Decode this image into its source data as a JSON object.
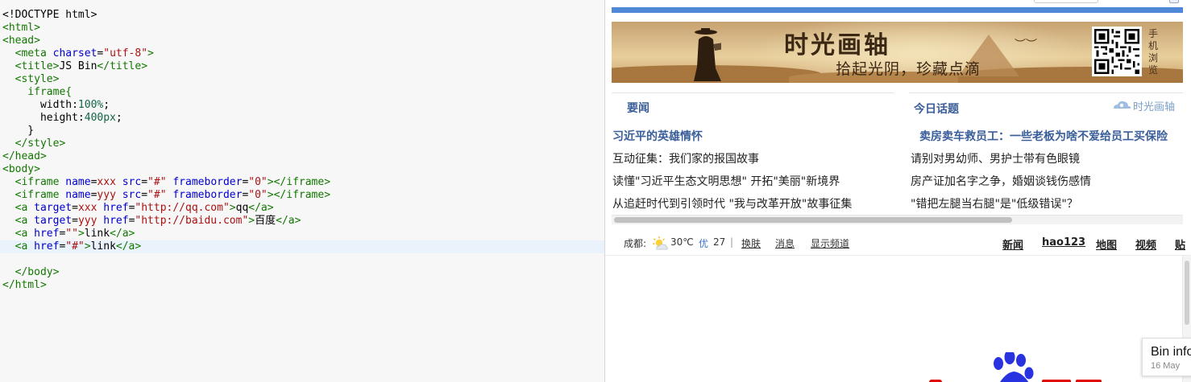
{
  "editor": {
    "lines": [
      {
        "tokens": [
          {
            "t": "<!DOCTYPE html>",
            "c": "pr"
          }
        ]
      },
      {
        "tokens": [
          {
            "t": "<html>",
            "c": "tg"
          }
        ]
      },
      {
        "tokens": [
          {
            "t": "<head>",
            "c": "tg"
          }
        ]
      },
      {
        "tokens": [
          {
            "t": "  ",
            "c": "pr"
          },
          {
            "t": "<meta ",
            "c": "tg"
          },
          {
            "t": "charset",
            "c": "at"
          },
          {
            "t": "=",
            "c": "pr"
          },
          {
            "t": "\"utf-8\"",
            "c": "st"
          },
          {
            "t": ">",
            "c": "tg"
          }
        ]
      },
      {
        "tokens": [
          {
            "t": "  ",
            "c": "pr"
          },
          {
            "t": "<title>",
            "c": "tg"
          },
          {
            "t": "JS Bin",
            "c": "pr"
          },
          {
            "t": "</title>",
            "c": "tg"
          }
        ]
      },
      {
        "tokens": [
          {
            "t": "  ",
            "c": "pr"
          },
          {
            "t": "<style>",
            "c": "tg"
          }
        ]
      },
      {
        "tokens": [
          {
            "t": "    iframe{",
            "c": "tg"
          }
        ]
      },
      {
        "tokens": [
          {
            "t": "      width:",
            "c": "pr"
          },
          {
            "t": "100%",
            "c": "nm"
          },
          {
            "t": ";",
            "c": "pr"
          }
        ]
      },
      {
        "tokens": [
          {
            "t": "      height:",
            "c": "pr"
          },
          {
            "t": "400px",
            "c": "nm"
          },
          {
            "t": ";",
            "c": "pr"
          }
        ]
      },
      {
        "tokens": [
          {
            "t": "    }",
            "c": "pr"
          }
        ]
      },
      {
        "tokens": [
          {
            "t": "  ",
            "c": "pr"
          },
          {
            "t": "</style>",
            "c": "tg"
          }
        ]
      },
      {
        "tokens": [
          {
            "t": "</head>",
            "c": "tg"
          }
        ]
      },
      {
        "tokens": [
          {
            "t": "<body>",
            "c": "tg"
          }
        ]
      },
      {
        "tokens": [
          {
            "t": "  ",
            "c": "pr"
          },
          {
            "t": "<iframe ",
            "c": "tg"
          },
          {
            "t": "name",
            "c": "at"
          },
          {
            "t": "=",
            "c": "pr"
          },
          {
            "t": "xxx ",
            "c": "st"
          },
          {
            "t": "src",
            "c": "at"
          },
          {
            "t": "=",
            "c": "pr"
          },
          {
            "t": "\"#\" ",
            "c": "st"
          },
          {
            "t": "frameborder",
            "c": "at"
          },
          {
            "t": "=",
            "c": "pr"
          },
          {
            "t": "\"0\"",
            "c": "st"
          },
          {
            "t": "></iframe>",
            "c": "tg"
          }
        ]
      },
      {
        "tokens": [
          {
            "t": "  ",
            "c": "pr"
          },
          {
            "t": "<iframe ",
            "c": "tg"
          },
          {
            "t": "name",
            "c": "at"
          },
          {
            "t": "=",
            "c": "pr"
          },
          {
            "t": "yyy ",
            "c": "st"
          },
          {
            "t": "src",
            "c": "at"
          },
          {
            "t": "=",
            "c": "pr"
          },
          {
            "t": "\"#\" ",
            "c": "st"
          },
          {
            "t": "frameborder",
            "c": "at"
          },
          {
            "t": "=",
            "c": "pr"
          },
          {
            "t": "\"0\"",
            "c": "st"
          },
          {
            "t": "></iframe>",
            "c": "tg"
          }
        ]
      },
      {
        "tokens": [
          {
            "t": "  ",
            "c": "pr"
          },
          {
            "t": "<a ",
            "c": "tg"
          },
          {
            "t": "target",
            "c": "at"
          },
          {
            "t": "=",
            "c": "pr"
          },
          {
            "t": "xxx ",
            "c": "st"
          },
          {
            "t": "href",
            "c": "at"
          },
          {
            "t": "=",
            "c": "pr"
          },
          {
            "t": "\"http://qq.com\"",
            "c": "st"
          },
          {
            "t": ">",
            "c": "tg"
          },
          {
            "t": "qq",
            "c": "pr"
          },
          {
            "t": "</a>",
            "c": "tg"
          }
        ]
      },
      {
        "tokens": [
          {
            "t": "  ",
            "c": "pr"
          },
          {
            "t": "<a ",
            "c": "tg"
          },
          {
            "t": "target",
            "c": "at"
          },
          {
            "t": "=",
            "c": "pr"
          },
          {
            "t": "yyy ",
            "c": "st"
          },
          {
            "t": "href",
            "c": "at"
          },
          {
            "t": "=",
            "c": "pr"
          },
          {
            "t": "\"http://baidu.com\"",
            "c": "st"
          },
          {
            "t": ">",
            "c": "tg"
          },
          {
            "t": "百度",
            "c": "pr"
          },
          {
            "t": "</a>",
            "c": "tg"
          }
        ]
      },
      {
        "tokens": [
          {
            "t": "  ",
            "c": "pr"
          },
          {
            "t": "<a ",
            "c": "tg"
          },
          {
            "t": "href",
            "c": "at"
          },
          {
            "t": "=",
            "c": "pr"
          },
          {
            "t": "\"\"",
            "c": "st"
          },
          {
            "t": ">",
            "c": "tg"
          },
          {
            "t": "link",
            "c": "pr"
          },
          {
            "t": "</a>",
            "c": "tg"
          }
        ]
      },
      {
        "tokens": [
          {
            "t": "  ",
            "c": "pr"
          },
          {
            "t": "<a ",
            "c": "tg"
          },
          {
            "t": "href",
            "c": "at"
          },
          {
            "t": "=",
            "c": "pr"
          },
          {
            "t": "\"#\"",
            "c": "st"
          },
          {
            "t": ">",
            "c": "tg"
          },
          {
            "t": "link",
            "c": "pr"
          },
          {
            "t": "</a>",
            "c": "tg"
          }
        ]
      },
      {
        "tokens": []
      },
      {
        "tokens": [
          {
            "t": "  ",
            "c": "pr"
          },
          {
            "t": "</body>",
            "c": "tg"
          }
        ]
      },
      {
        "tokens": [
          {
            "t": "</html>",
            "c": "tg"
          }
        ]
      }
    ],
    "active_line": 18
  },
  "qq_frame": {
    "banner_title": "时光画轴",
    "banner_subtitle": "拾起光阴，珍藏点滴",
    "qr_label": "手机浏览",
    "sections": {
      "left_title": "要闻",
      "right_title": "今日话题",
      "brand": "时光画轴"
    },
    "left_news": [
      "习近平的英雄情怀",
      "互动征集：我们家的报国故事",
      "读懂\"习近平生态文明思想\" 开拓\"美丽\"新境界",
      "从追赶时代到引领时代 \"我与改革开放\"故事征集"
    ],
    "right_news": [
      "卖房卖车救员工：一些老板为啥不爱给员工买保险",
      "请别对男幼师、男护士带有色眼镜",
      "房产证加名字之争，婚姻谈钱伤感情",
      "\"错把左腿当右腿\"是\"低级错误\"？"
    ]
  },
  "baidu_frame": {
    "city": "成都:",
    "temperature": "30℃",
    "air_quality": "优",
    "aqi": "27",
    "separator": "|",
    "skin": "换肤",
    "messages": "消息",
    "show_channels": "显示频道",
    "nav": [
      "新闻",
      "hao123",
      "地图",
      "视频",
      "贴"
    ]
  },
  "bin_info": {
    "title": "Bin info",
    "date": "16 May"
  },
  "colors": {
    "accent_blue": "#4f88d7",
    "news_heading": "#3a5e9a",
    "baidu_blue": "#2932e1",
    "baidu_red": "#e10602"
  },
  "icons": [
    "weather-partly-sunny-icon",
    "qr-code-icon",
    "brand-cloud-icon",
    "baidu-paw-icon"
  ]
}
